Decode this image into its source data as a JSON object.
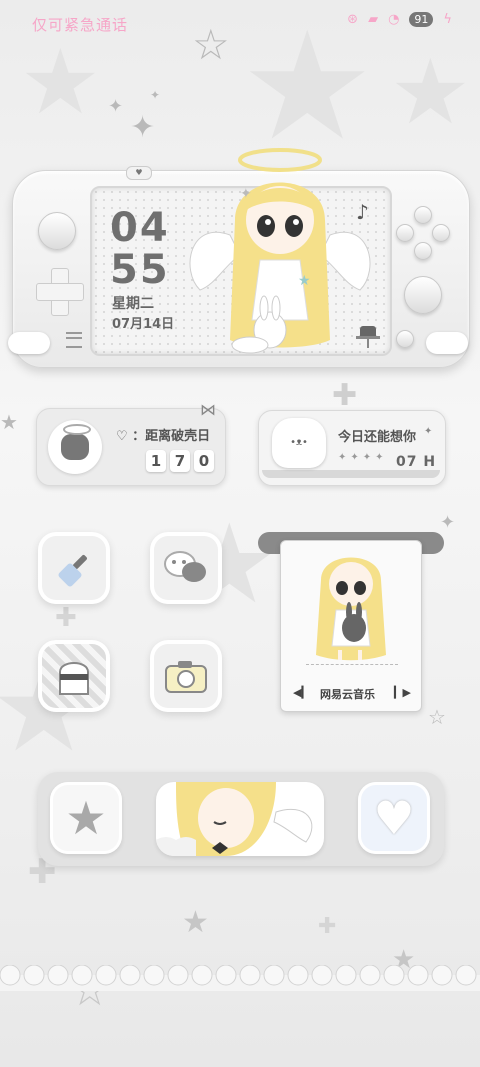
{
  "status_bar": {
    "left_text": "仅可紧急通话",
    "battery_level": "91"
  },
  "clock_widget": {
    "hour": "04",
    "minute": "55",
    "weekday": "星期二",
    "date": "07月14日"
  },
  "countdown_widget": {
    "label": "♡ ：距离破壳日",
    "digits": [
      "1",
      "7",
      "0"
    ]
  },
  "think_widget": {
    "text": "今日还能想你",
    "hours": "07 H"
  },
  "music_widget": {
    "label": "网易云音乐",
    "prev_icon": "play-left-icon",
    "next_icon": "play-right-icon"
  },
  "apps": [
    {
      "icon": "brush-icon"
    },
    {
      "icon": "wechat-icon"
    },
    {
      "icon": "ghost-checker-icon"
    },
    {
      "icon": "camera-icon"
    }
  ],
  "dock": [
    {
      "icon": "star-icon"
    },
    {
      "icon": "angel-photo-icon"
    },
    {
      "icon": "heart-icon"
    }
  ],
  "colors": {
    "status_pink": "#f6a6c8",
    "accent_yellow": "#f5e08a",
    "grey_text": "#666666"
  }
}
